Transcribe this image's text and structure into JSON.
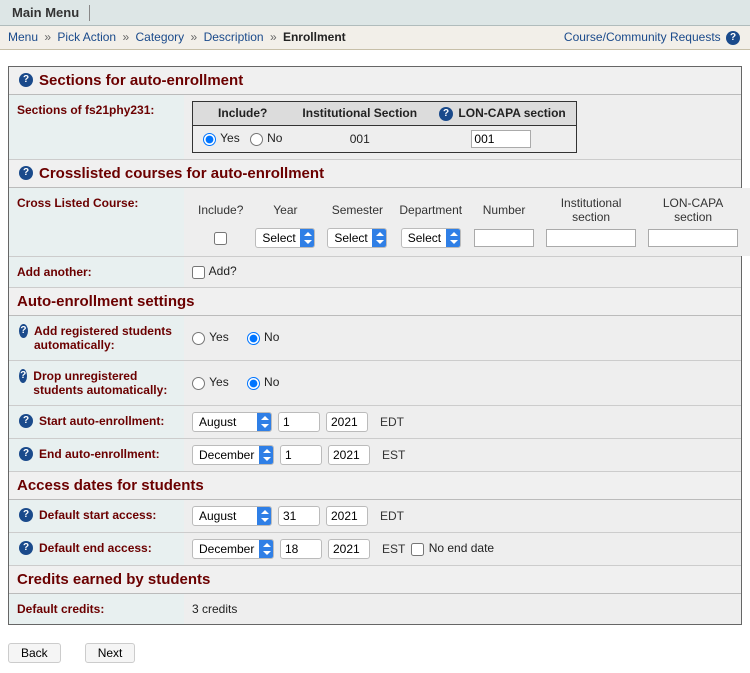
{
  "topbar": {
    "title": "Main Menu"
  },
  "breadcrumb": {
    "items": [
      "Menu",
      "Pick Action",
      "Category",
      "Description"
    ],
    "current": "Enrollment",
    "right_label": "Course/Community Requests"
  },
  "sections_auto": {
    "header": "Sections for auto-enrollment",
    "label": "Sections of fs21phy231:",
    "table": {
      "h_include": "Include?",
      "h_inst": "Institutional Section",
      "h_lc": "LON-CAPA section",
      "opt_yes": "Yes",
      "opt_no": "No",
      "inst_val": "001",
      "lc_val": "001"
    }
  },
  "crosslist": {
    "header": "Crosslisted courses for auto-enrollment",
    "label": "Cross Listed Course:",
    "cols": {
      "include": "Include?",
      "year": "Year",
      "semester": "Semester",
      "department": "Department",
      "number": "Number",
      "inst": "Institutional section",
      "lc": "LON-CAPA section"
    },
    "sel_default": "Select",
    "add_label": "Add another:",
    "add_check": "Add?"
  },
  "autoenroll": {
    "header": "Auto-enrollment settings",
    "add_label": "Add registered students automatically:",
    "drop_label": "Drop unregistered students automatically:",
    "start_label": "Start auto-enrollment:",
    "end_label": "End auto-enrollment:",
    "yes": "Yes",
    "no": "No",
    "start": {
      "month": "August",
      "day": "1",
      "year": "2021",
      "tz": "EDT"
    },
    "end": {
      "month": "December",
      "day": "1",
      "year": "2021",
      "tz": "EST"
    }
  },
  "access": {
    "header": "Access dates for students",
    "start_label": "Default start access:",
    "end_label": "Default end access:",
    "noend_label": "No end date",
    "start": {
      "month": "August",
      "day": "31",
      "year": "2021",
      "tz": "EDT"
    },
    "end": {
      "month": "December",
      "day": "18",
      "year": "2021",
      "tz": "EST"
    }
  },
  "credits": {
    "header": "Credits earned by students",
    "label": "Default credits:",
    "value": "3 credits"
  },
  "buttons": {
    "back": "Back",
    "next": "Next"
  }
}
